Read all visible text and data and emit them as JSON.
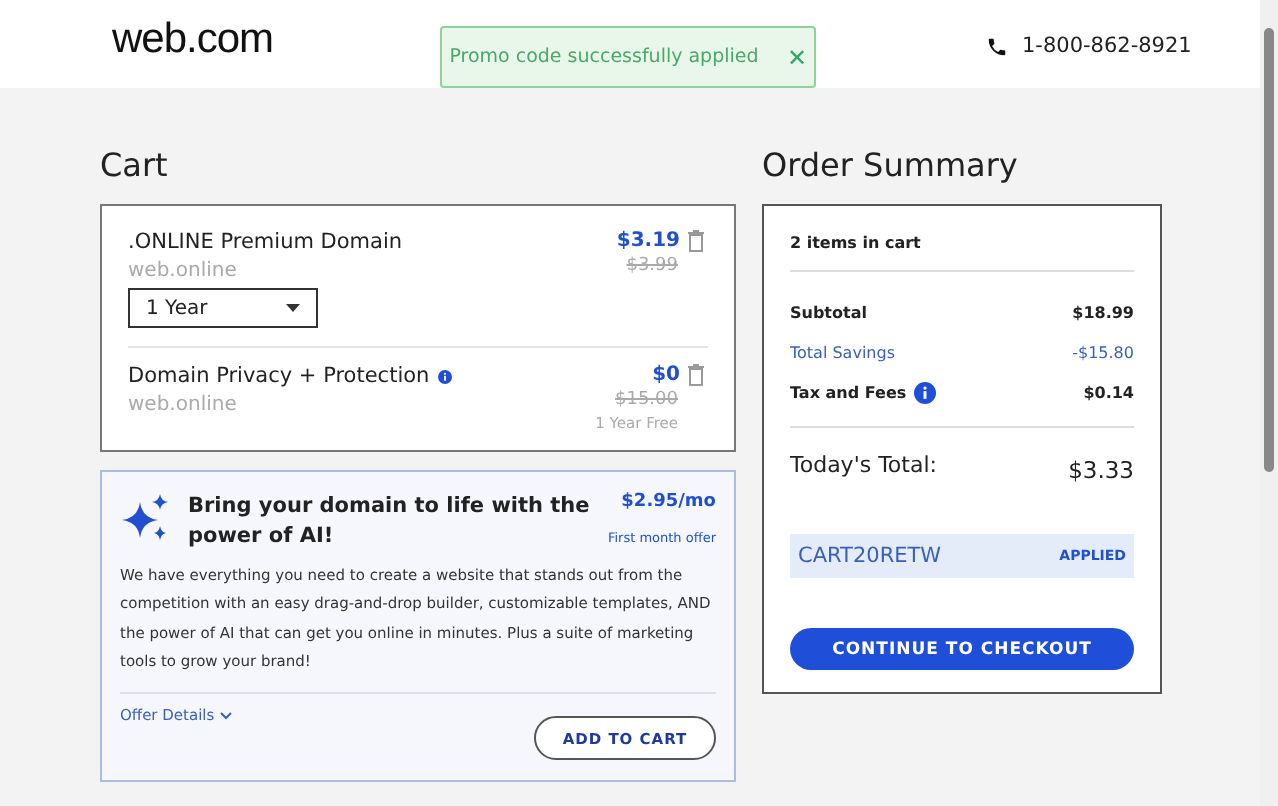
{
  "header": {
    "logo": "web.com",
    "phone": "1-800-862-8921"
  },
  "toast": {
    "message": "Promo code successfully applied",
    "close": "✕"
  },
  "cart": {
    "title": "Cart",
    "items": [
      {
        "name": ".ONLINE Premium Domain",
        "info": false,
        "domain": "web.online",
        "price": "$3.19",
        "old_price": "$3.99",
        "term": "1 Year"
      },
      {
        "name": "Domain Privacy + Protection",
        "info": true,
        "domain": "web.online",
        "price": "$0",
        "old_price": "$15.00",
        "note": "1 Year Free"
      }
    ]
  },
  "offer": {
    "title": "Bring your domain to life with the power of AI!",
    "price": "$2.95/mo",
    "price_note": "First month offer",
    "body": "We have everything you need to create a website that stands out from the competition with an easy drag-and-drop builder, customizable templates, AND the power of AI that can get you online in minutes. Plus a suite of marketing tools to grow your brand!",
    "details": "Offer Details",
    "button": "ADD TO CART"
  },
  "summary": {
    "title": "Order Summary",
    "count": "2 items in cart",
    "rows": [
      {
        "kind": "plain",
        "label": "Subtotal",
        "info": false,
        "value": "$18.99"
      },
      {
        "kind": "savings",
        "label": "Total Savings",
        "info": false,
        "value": "-$15.80"
      },
      {
        "kind": "plain",
        "label": "Tax and Fees",
        "info": true,
        "value": "$0.14"
      }
    ],
    "total_label": "Today's Total:",
    "total": "$3.33",
    "promo_code": "CART20RETW",
    "promo_status": "APPLIED",
    "checkout": "CONTINUE TO CHECKOUT"
  }
}
